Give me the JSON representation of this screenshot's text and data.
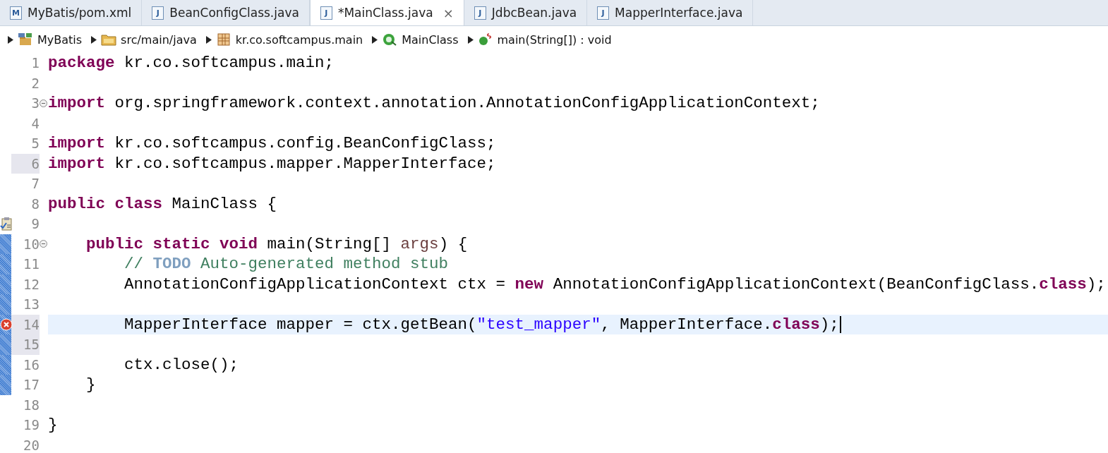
{
  "tabs": [
    {
      "icon": "M",
      "label": "MyBatis/pom.xml",
      "selected": false
    },
    {
      "icon": "J",
      "label": "BeanConfigClass.java",
      "selected": false
    },
    {
      "icon": "J",
      "label": "*MainClass.java",
      "selected": true,
      "close": "×"
    },
    {
      "icon": "J",
      "label": "JdbcBean.java",
      "selected": false
    },
    {
      "icon": "J",
      "label": "MapperInterface.java",
      "selected": false
    }
  ],
  "breadcrumb": [
    {
      "kind": "project",
      "label": "MyBatis"
    },
    {
      "kind": "source-folder",
      "label": "src/main/java"
    },
    {
      "kind": "package",
      "label": "kr.co.softcampus.main"
    },
    {
      "kind": "class",
      "label": "MainClass"
    },
    {
      "kind": "method",
      "label": "main(String[]) : void"
    }
  ],
  "editor": {
    "lines": [
      {
        "number": "1",
        "current": false,
        "changed": false,
        "marked": false,
        "tokens": [
          {
            "kind": "keyword",
            "text": "package"
          },
          {
            "kind": "plain",
            "text": " kr.co.softcampus.main;"
          }
        ]
      },
      {
        "number": "2",
        "current": false,
        "changed": false,
        "marked": false
      },
      {
        "number": "3",
        "current": false,
        "changed": false,
        "marked": false,
        "fold_marker": {
          "expanded": true
        },
        "tokens": [
          {
            "kind": "keyword",
            "text": "import"
          },
          {
            "kind": "plain",
            "text": " org.springframework.context.annotation.AnnotationConfigApplicationContext;"
          }
        ]
      },
      {
        "number": "4",
        "current": false,
        "changed": false,
        "marked": false
      },
      {
        "number": "5",
        "current": false,
        "changed": false,
        "marked": false,
        "tokens": [
          {
            "kind": "keyword",
            "text": "import"
          },
          {
            "kind": "plain",
            "text": " kr.co.softcampus.config.BeanConfigClass;"
          }
        ]
      },
      {
        "number": "6",
        "current": false,
        "changed": false,
        "marked": true,
        "tokens": [
          {
            "kind": "keyword",
            "text": "import"
          },
          {
            "kind": "plain",
            "text": " kr.co.softcampus.mapper.MapperInterface;"
          }
        ]
      },
      {
        "number": "7",
        "current": false,
        "changed": false,
        "marked": false
      },
      {
        "number": "8",
        "current": false,
        "changed": false,
        "marked": false,
        "tokens": [
          {
            "kind": "keyword",
            "text": "public class"
          },
          {
            "kind": "plain",
            "text": " MainClass {"
          }
        ]
      },
      {
        "number": "9",
        "current": false,
        "changed": false,
        "marked": false,
        "gutter_icon": {
          "kind": "task"
        }
      },
      {
        "number": "10",
        "current": false,
        "changed": true,
        "marked": false,
        "fold_marker": {
          "expanded": true
        },
        "tokens": [
          {
            "kind": "keyword",
            "text": "    public static void"
          },
          {
            "kind": "plain",
            "text": " main(String[] "
          },
          {
            "kind": "param",
            "text": "args"
          },
          {
            "kind": "plain",
            "text": ") {"
          }
        ]
      },
      {
        "number": "11",
        "current": false,
        "changed": true,
        "marked": false,
        "tokens": [
          {
            "kind": "comment",
            "text": "        // "
          },
          {
            "kind": "todo",
            "text": "TODO"
          },
          {
            "kind": "comment",
            "text": " Auto-generated method stub"
          }
        ]
      },
      {
        "number": "12",
        "current": false,
        "changed": true,
        "marked": false,
        "tokens": [
          {
            "kind": "plain",
            "text": "        AnnotationConfigApplicationContext ctx = "
          },
          {
            "kind": "keyword",
            "text": "new"
          },
          {
            "kind": "plain",
            "text": " AnnotationConfigApplicationContext(BeanConfigClass."
          },
          {
            "kind": "keyword",
            "text": "class"
          },
          {
            "kind": "plain",
            "text": ");"
          }
        ]
      },
      {
        "number": "13",
        "current": false,
        "changed": true,
        "marked": false
      },
      {
        "number": "14",
        "current": true,
        "changed": true,
        "marked": true,
        "gutter_icon": {
          "kind": "error"
        },
        "tokens": [
          {
            "kind": "plain",
            "text": "        MapperInterface mapper = ctx.getBean("
          },
          {
            "kind": "string",
            "text": "\"test_mapper\""
          },
          {
            "kind": "plain",
            "text": ", MapperInterface."
          },
          {
            "kind": "keyword",
            "text": "class"
          },
          {
            "kind": "plain",
            "text": ");"
          }
        ]
      },
      {
        "number": "15",
        "current": false,
        "changed": true,
        "marked": true
      },
      {
        "number": "16",
        "current": false,
        "changed": true,
        "marked": false,
        "tokens": [
          {
            "kind": "plain",
            "text": "        ctx.close();"
          }
        ]
      },
      {
        "number": "17",
        "current": false,
        "changed": true,
        "marked": false,
        "tokens": [
          {
            "kind": "plain",
            "text": "    }"
          }
        ]
      },
      {
        "number": "18",
        "current": false,
        "changed": false,
        "marked": false
      },
      {
        "number": "19",
        "current": false,
        "changed": false,
        "marked": false,
        "tokens": [
          {
            "kind": "plain",
            "text": "}"
          }
        ]
      },
      {
        "number": "20",
        "current": false,
        "changed": false,
        "marked": false
      }
    ]
  }
}
